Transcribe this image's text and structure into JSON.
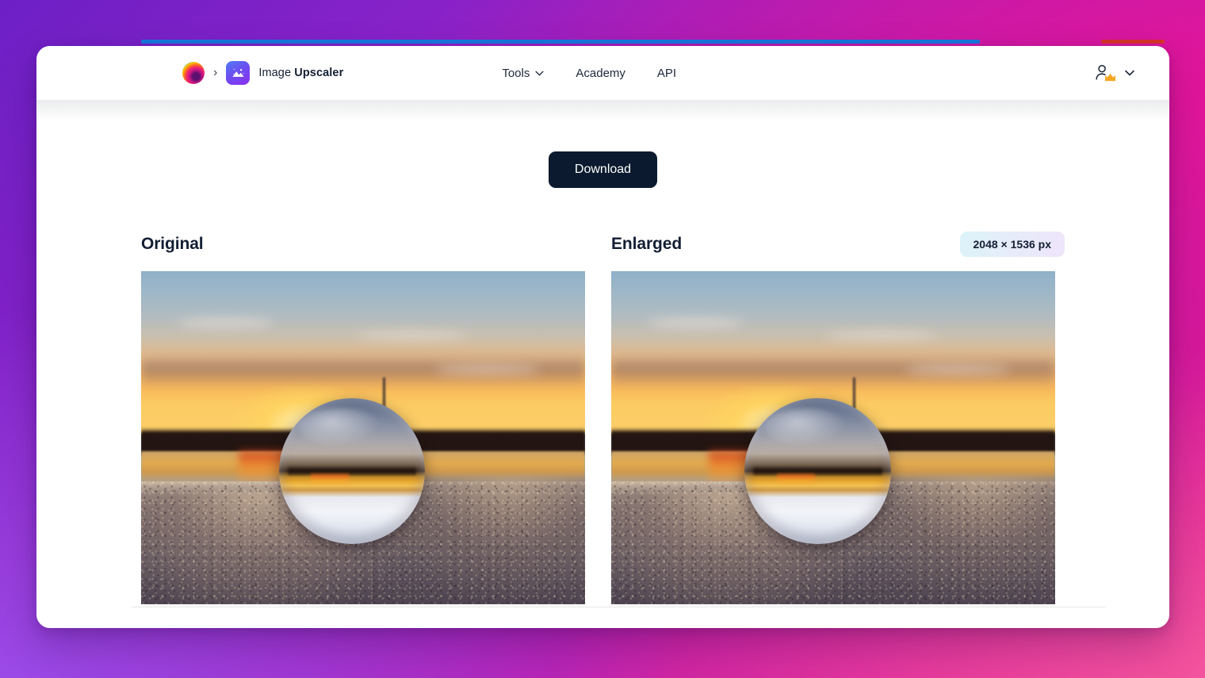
{
  "browser": {
    "progress_bar_color": "#1877e0",
    "secondary_bar_color": "#d9332c"
  },
  "header": {
    "logo_icon": "brand-orb-icon",
    "breadcrumb_separator": "›",
    "app_icon": "image-mountain-icon",
    "brand_prefix": "Image",
    "brand_name": "Upscaler",
    "nav": [
      {
        "label": "Tools",
        "has_dropdown": true,
        "icon": "chevron-down-icon"
      },
      {
        "label": "Academy",
        "has_dropdown": false
      },
      {
        "label": "API",
        "has_dropdown": false
      }
    ],
    "account": {
      "avatar_icon": "person-icon",
      "badge_icon": "crown-icon",
      "badge_color": "#f5a623",
      "caret_icon": "chevron-down-icon"
    }
  },
  "main": {
    "download_label": "Download",
    "download_bg": "#0b1a2e",
    "panels": {
      "original_label": "Original",
      "enlarged_label": "Enlarged",
      "size_badge": "2048 × 1536 px",
      "badge_gradient_from": "#dbf3f8",
      "badge_gradient_to": "#efe5fb"
    },
    "images": {
      "original_alt": "lensball resting on sand at sunset — original resolution",
      "enlarged_alt": "lensball resting on sand at sunset — upscaled result"
    }
  },
  "theme": {
    "page_gradient_start": "#6d20c6",
    "page_gradient_end": "#e4178f",
    "text_dark": "#131e33",
    "card_bg": "#ffffff"
  }
}
